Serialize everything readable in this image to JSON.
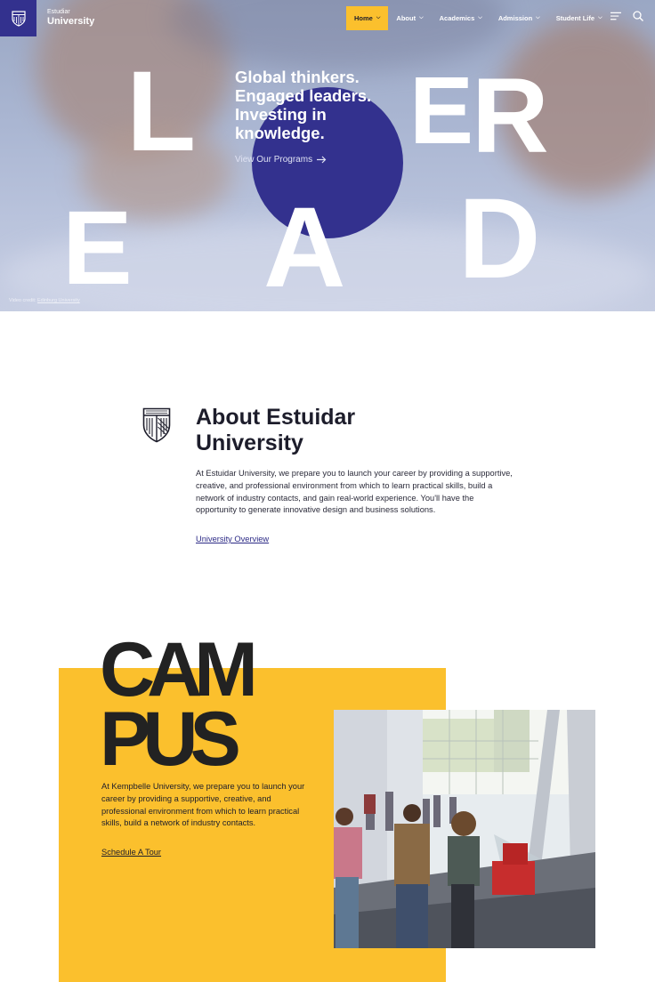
{
  "brand": {
    "small": "Estudiar",
    "big": "University"
  },
  "nav": {
    "items": [
      {
        "label": "Home",
        "active": true
      },
      {
        "label": "About",
        "active": false
      },
      {
        "label": "Academics",
        "active": false
      },
      {
        "label": "Admission",
        "active": false
      },
      {
        "label": "Student Life",
        "active": false
      }
    ],
    "icons": [
      "menu-icon",
      "search-icon",
      "chevron-down-icon"
    ]
  },
  "hero": {
    "letters": [
      "L",
      "E",
      "R",
      "E",
      "A",
      "D"
    ],
    "headline": [
      "Global thinkers.",
      "Engaged leaders.",
      "Investing in",
      "knowledge."
    ],
    "cta": "View Our Programs",
    "credit_prefix": "Video credit: ",
    "credit_link": "Edinburg University"
  },
  "about": {
    "title_line1": "About Estuidar",
    "title_line2": "University",
    "body": "At Estuidar University, we prepare you to launch your career by providing a supportive, creative, and professional environment from which to learn practical skills, build a network of industry contacts, and gain real-world experience. You'll have the opportunity to generate innovative design and business solutions.",
    "link": "University Overview"
  },
  "campus": {
    "word_line1": "CAM",
    "word_line2": "PUS",
    "body": "At Kempbelle University, we prepare you to launch your career by providing a supportive, creative, and professional environment from which to learn practical skills, build a network of industry contacts.",
    "link": "Schedule A Tour"
  },
  "colors": {
    "primary": "#33318e",
    "accent": "#fbc02d",
    "text": "#1d1d2b"
  }
}
